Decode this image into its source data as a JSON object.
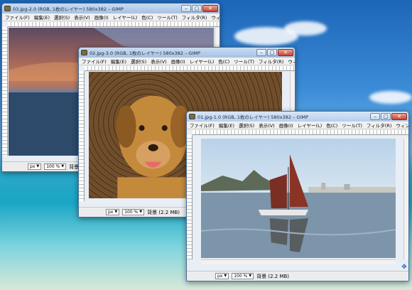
{
  "windows": [
    {
      "title": "03.jpg-2.0 (RGB, 1枚のレイヤー) 580x382 – GIMP",
      "menu": [
        "ファイル(F)",
        "編集(E)",
        "選択(S)",
        "表示(V)",
        "画像(I)",
        "レイヤー(L)",
        "色(C)",
        "ツール(T)",
        "フィルタ(R)",
        "ウィンドウ"
      ],
      "unit": "px",
      "zoom": "100 %",
      "status": "背景"
    },
    {
      "title": "02.jpg-3.0 (RGB, 1枚のレイヤー) 580x382 – GIMP",
      "menu": [
        "ファイル(F)",
        "編集(E)",
        "選択(S)",
        "表示(V)",
        "画像(I)",
        "レイヤー(L)",
        "色(C)",
        "ツール(T)",
        "フィルタ(R)",
        "ウィンド"
      ],
      "unit": "px",
      "zoom": "100 %",
      "status": "背景 (2.2 MB)"
    },
    {
      "title": "01.jpg-1.0 (RGB, 1枚のレイヤー) 580x382 – GIMP",
      "menu": [
        "ファイル(F)",
        "編集(E)",
        "選択(S)",
        "表示(V)",
        "画像(I)",
        "レイヤー(L)",
        "色(C)",
        "ツール(T)",
        "フィルタ(R)",
        "ウィンドウ"
      ],
      "unit": "px",
      "zoom": "100 %",
      "status": "背景 (2.2 MB)"
    }
  ],
  "window_buttons": {
    "minimize": "–",
    "maximize": "□",
    "close": "✕"
  },
  "colors": {
    "accent": "#4a6f98",
    "close": "#c8432f"
  }
}
